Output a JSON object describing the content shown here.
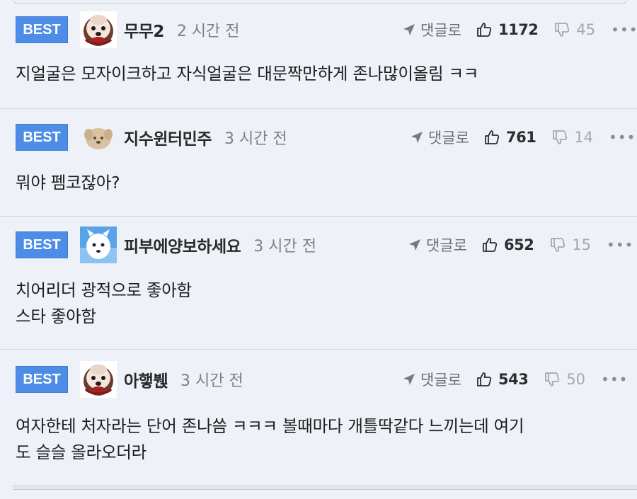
{
  "comments": [
    {
      "badge": "BEST",
      "nickname": "무무2",
      "time": "2 시간 전",
      "reply_label": "댓글로",
      "likes": "1172",
      "dislikes": "45",
      "more": "•••",
      "lines": [
        "지얼굴은 모자이크하고 자식얼굴은 대문짝만하게 존나많이올림 ㅋㅋ"
      ]
    },
    {
      "badge": "BEST",
      "nickname": "지수윈터민주",
      "time": "3 시간 전",
      "reply_label": "댓글로",
      "likes": "761",
      "dislikes": "14",
      "more": "•••",
      "lines": [
        "뭐야 펨코잖아?"
      ]
    },
    {
      "badge": "BEST",
      "nickname": "피부에양보하세요",
      "time": "3 시간 전",
      "reply_label": "댓글로",
      "likes": "652",
      "dislikes": "15",
      "more": "•••",
      "lines": [
        "치어리더 광적으로 좋아함",
        "스타 좋아함"
      ]
    },
    {
      "badge": "BEST",
      "nickname": "아햏붽",
      "time": "3 시간 전",
      "reply_label": "댓글로",
      "likes": "543",
      "dislikes": "50",
      "more": "•••",
      "lines": [
        "여자한테 처자라는 단어 존나씀 ㅋㅋㅋ 볼때마다 개틀딱같다 느끼는데 여기",
        "도 슬슬 올라오더라"
      ]
    }
  ],
  "icons": {
    "reply": "reply-arrow-icon",
    "like": "thumbs-up-icon",
    "dislike": "thumbs-down-icon",
    "more": "more-dots-icon"
  },
  "colors": {
    "badge": "#4d8de8",
    "background": "#eef1f7"
  }
}
